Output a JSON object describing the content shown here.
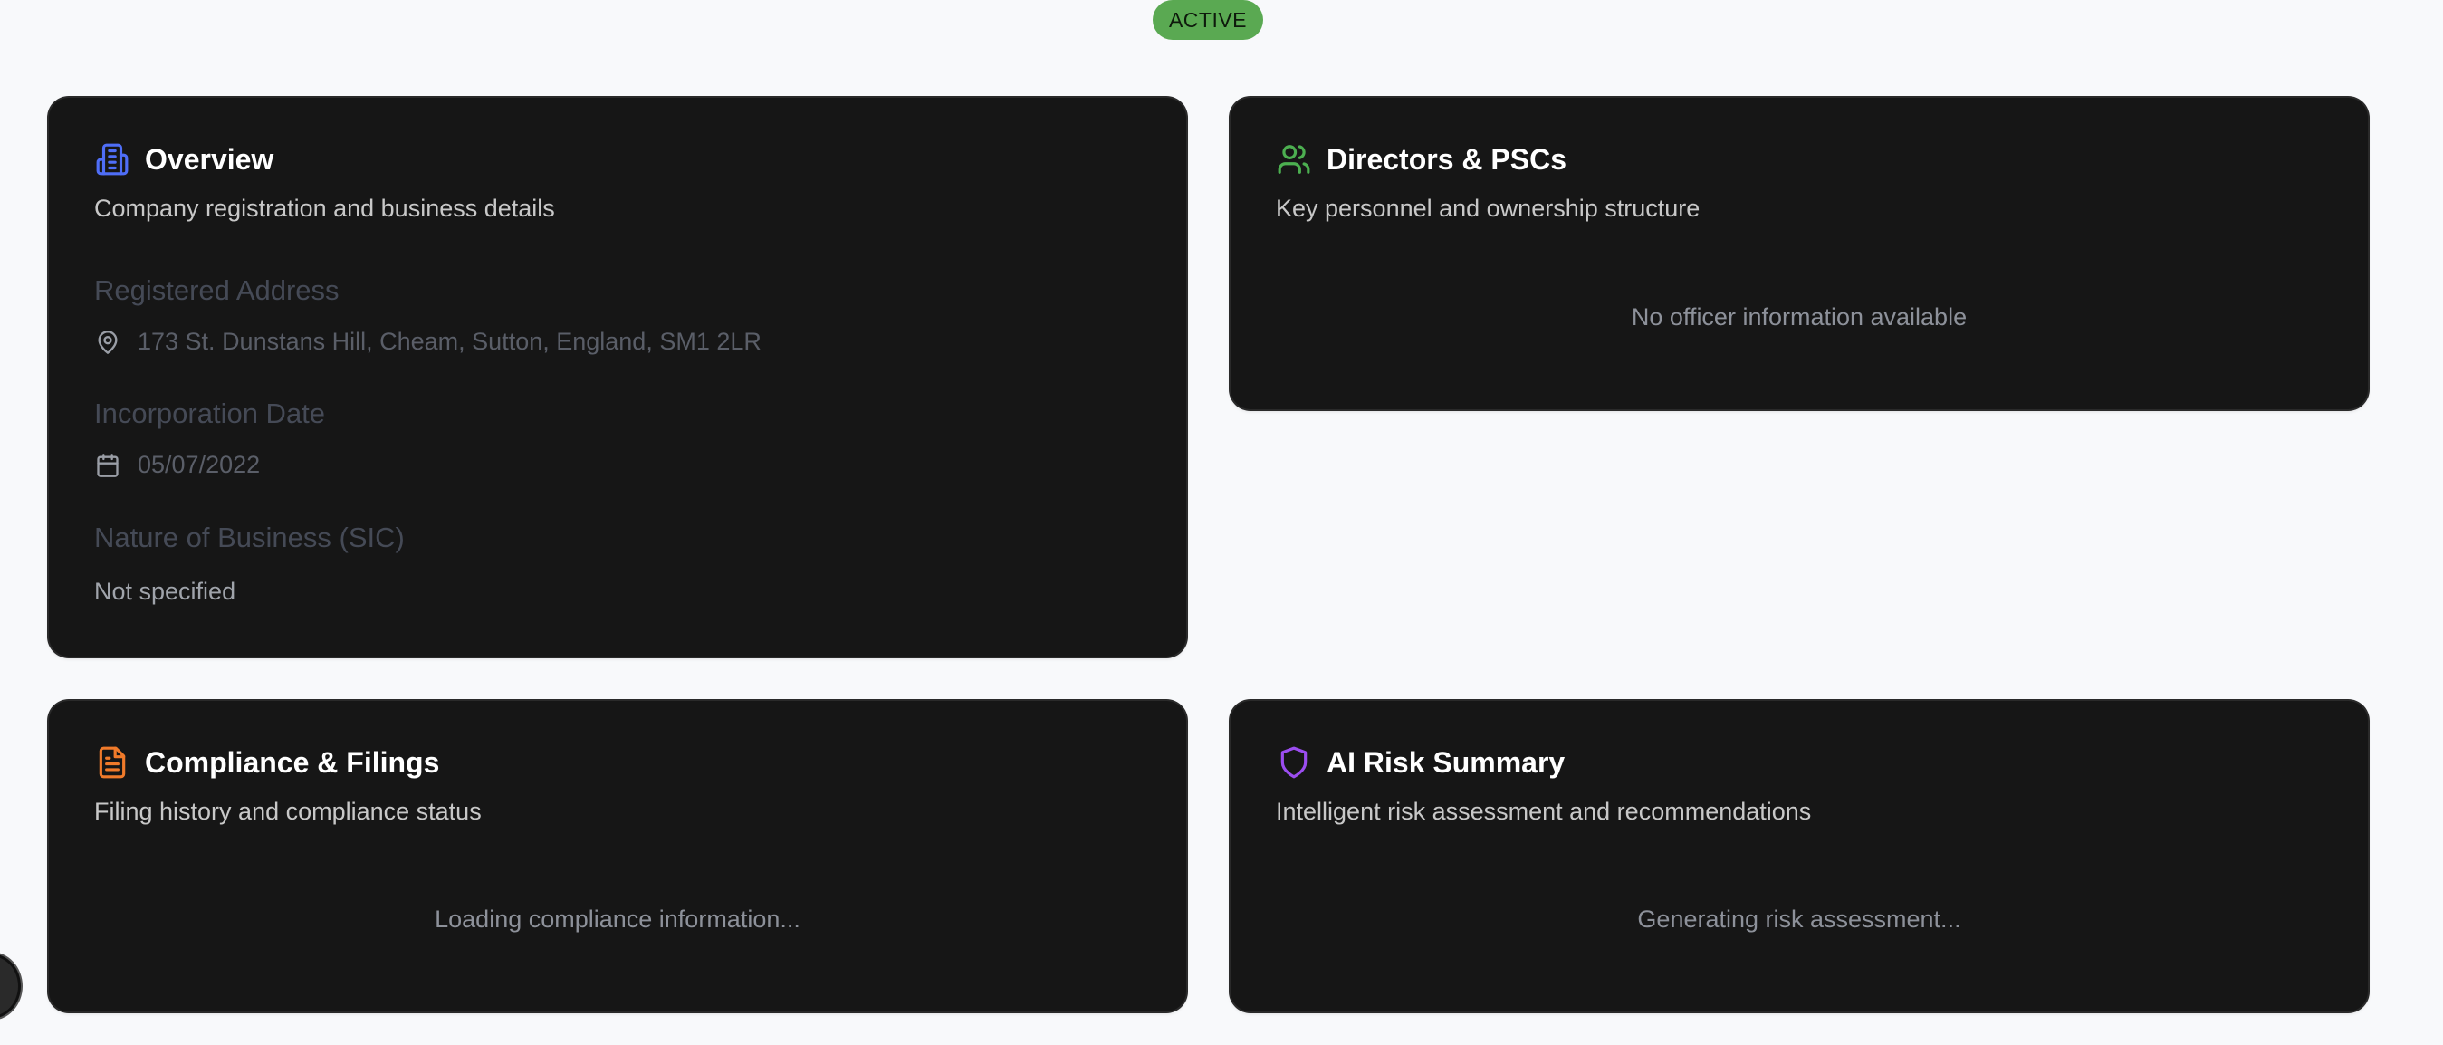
{
  "status": {
    "label": "ACTIVE",
    "color": "#5aa952"
  },
  "overview": {
    "icon": "building-icon",
    "title": "Overview",
    "subtitle": "Company registration and business details",
    "registered_address": {
      "label": "Registered Address",
      "icon": "map-pin-icon",
      "value": "173 St. Dunstans Hill, Cheam, Sutton, England, SM1 2LR"
    },
    "incorporation_date": {
      "label": "Incorporation Date",
      "icon": "calendar-icon",
      "value": "05/07/2022"
    },
    "sic": {
      "label": "Nature of Business (SIC)",
      "value": "Not specified"
    }
  },
  "directors": {
    "icon": "users-icon",
    "title": "Directors & PSCs",
    "subtitle": "Key personnel and ownership structure",
    "message": "No officer information available"
  },
  "compliance": {
    "icon": "file-text-icon",
    "title": "Compliance & Filings",
    "subtitle": "Filing history and compliance status",
    "message": "Loading compliance information..."
  },
  "risk": {
    "icon": "shield-icon",
    "title": "AI Risk Summary",
    "subtitle": "Intelligent risk assessment and recommendations",
    "message": "Generating risk assessment..."
  },
  "colors": {
    "card_bg": "#161616",
    "overview_icon": "#4f6ef7",
    "directors_icon": "#4caf50",
    "compliance_icon": "#f07a2a",
    "risk_icon": "#9b4df0"
  }
}
